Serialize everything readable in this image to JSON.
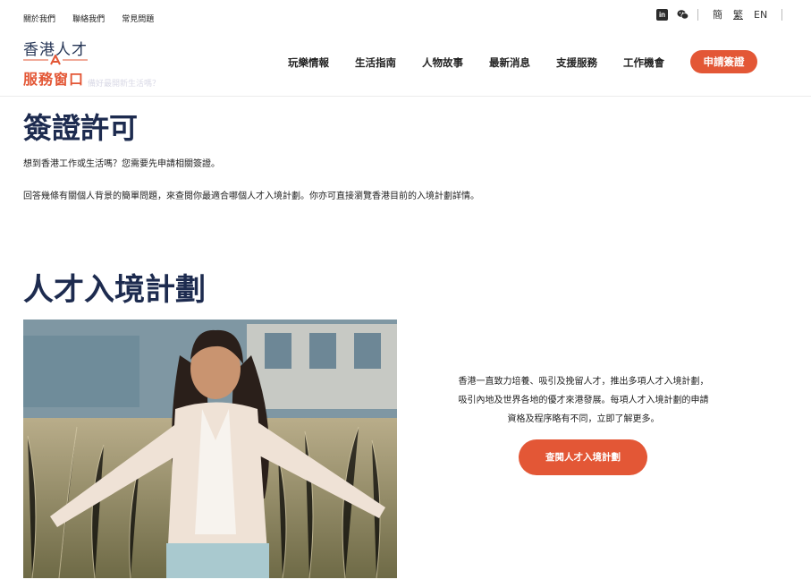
{
  "top_links": [
    "關於我們",
    "聯絡我們",
    "常見問題"
  ],
  "social": {
    "linkedin": "in"
  },
  "languages": [
    "簡",
    "繁",
    "EN"
  ],
  "logo": {
    "line1": "香港人才",
    "line2": "服務窗口"
  },
  "ghost_text": "備好最開新生活嗎？",
  "main_nav": [
    "玩樂情報",
    "生活指南",
    "人物故事",
    "最新消息",
    "支援服務",
    "工作機會"
  ],
  "apply_button": "申請簽證",
  "visa": {
    "title": "簽證許可",
    "p1": "想到香港工作或生活嗎？您需要先申請相關簽證。",
    "p2": "回答幾條有關個人背景的簡單問題，來查閱你最適合哪個人才入境計劃。你亦可直接瀏覽香港目前的入境計劃詳情。"
  },
  "scheme": {
    "title": "人才入境計劃",
    "desc_lines": [
      "香港一直致力培養、吸引及挽留人才，推出多項人才入境計劃，",
      "吸引內地及世界各地的優才來港發展。每項人才入境計劃的申請",
      "資格及程序略有不同，立即了解更多。"
    ],
    "cta": "查閱人才入境計劃"
  },
  "colors": {
    "brand_orange": "#e35736",
    "navy": "#1d2b4f"
  }
}
